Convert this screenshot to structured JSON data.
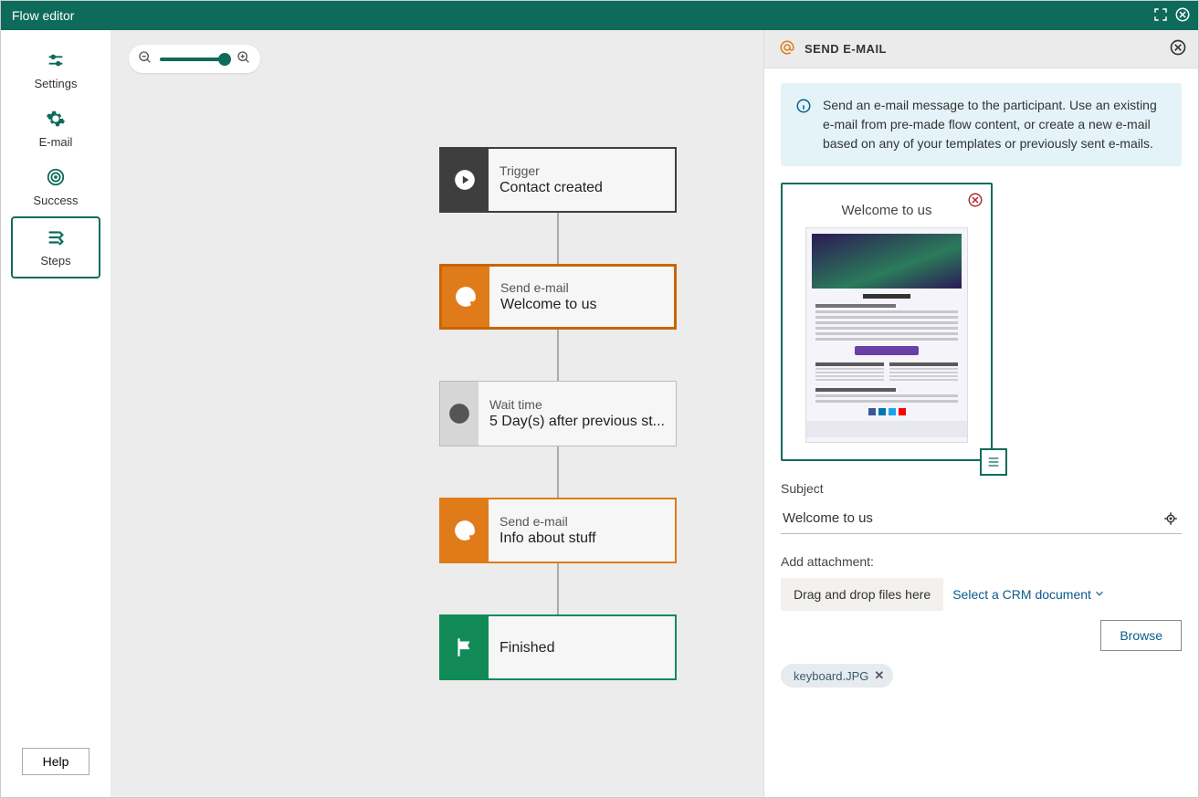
{
  "window": {
    "title": "Flow editor"
  },
  "sidebar": {
    "settings": "Settings",
    "email": "E-mail",
    "success": "Success",
    "steps": "Steps",
    "help": "Help"
  },
  "flow": {
    "trigger": {
      "title": "Trigger",
      "sub": "Contact created"
    },
    "email1": {
      "title": "Send e-mail",
      "sub": "Welcome to us"
    },
    "wait": {
      "title": "Wait time",
      "sub": "5 Day(s) after previous st..."
    },
    "email2": {
      "title": "Send e-mail",
      "sub": "Info about stuff"
    },
    "finish": {
      "title": "Finished"
    }
  },
  "panel": {
    "header": "SEND E-MAIL",
    "info": "Send an e-mail message to the participant. Use an existing e-mail from pre-made flow content, or create a new e-mail based on any of your templates or previously sent e-mails.",
    "preview_title": "Welcome to us",
    "subject_label": "Subject",
    "subject_value": "Welcome to us",
    "attach_label": "Add attachment:",
    "dropzone": "Drag and drop files here",
    "crm_select": "Select a CRM document",
    "browse": "Browse",
    "chip": "keyboard.JPG"
  }
}
